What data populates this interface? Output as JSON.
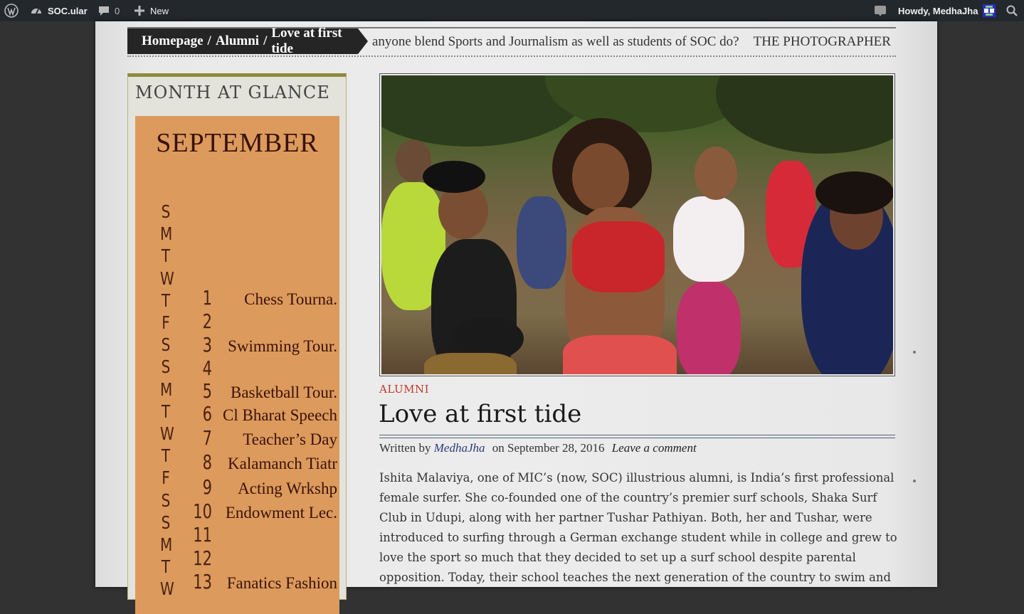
{
  "admin_bar": {
    "site_name": "SOC.ular",
    "comment_count": "0",
    "new_label": "New",
    "greeting": "Howdy, MedhaJha",
    "icons": [
      "wordpress-icon",
      "dashboard-icon",
      "comment-icon",
      "plus-icon",
      "notification-icon",
      "avatar",
      "search-icon"
    ]
  },
  "breadcrumb": {
    "home": "Homepage",
    "separator": "/",
    "section": "Alumni",
    "current": "Love at first tide"
  },
  "ticker": {
    "item1": "anyone blend Sports and Journalism as well as students of SOC do?",
    "item2": "THE PHOTOGRAPHER"
  },
  "widget": {
    "title": "MONTH AT GLANCE",
    "month": "SEPTEMBER",
    "weekdays": [
      "S",
      "M",
      "T",
      "W",
      "T",
      "F",
      "S",
      "S",
      "M",
      "T",
      "W",
      "T",
      "F",
      "S",
      "S",
      "M",
      "T",
      "W"
    ],
    "days": [
      {
        "num": "1",
        "event": "Chess Tourna."
      },
      {
        "num": "2",
        "event": ""
      },
      {
        "num": "3",
        "event": "Swimming Tour."
      },
      {
        "num": "4",
        "event": ""
      },
      {
        "num": "5",
        "event": "Basketball Tour."
      },
      {
        "num": "6",
        "event": "Cl Bharat Speech"
      },
      {
        "num": "7",
        "event": "Teacher’s Day"
      },
      {
        "num": "8",
        "event": "Kalamanch Tiatr"
      },
      {
        "num": "9",
        "event": "Acting Wrkshp"
      },
      {
        "num": "10",
        "event": "Endowment Lec."
      },
      {
        "num": "11",
        "event": ""
      },
      {
        "num": "12",
        "event": ""
      },
      {
        "num": "13",
        "event": "Fanatics Fashion"
      }
    ]
  },
  "post": {
    "category": "ALUMNI",
    "title": "Love at first tide",
    "written_by": "Written by",
    "author": "MedhaJha",
    "date_prefix": "on",
    "date": "September 28, 2016",
    "comment_link": "Leave a comment",
    "body": "Ishita Malaviya, one of MIC’s (now, SOC) illustrious alumni, is India’s first professional female surfer. She co-founded one of the country’s premier surf schools, Shaka Surf Club in Udupi, along with her partner Tushar Pathiyan. Both, her and Tushar, were introduced to surfing through a German exchange student while in college and grew to love the sport so much that they decided to set up a surf school despite parental opposition. Today, their school teaches the next generation of the country to swim and surf and has become a force to reckon with in the",
    "image_alt": "runners-photo"
  }
}
